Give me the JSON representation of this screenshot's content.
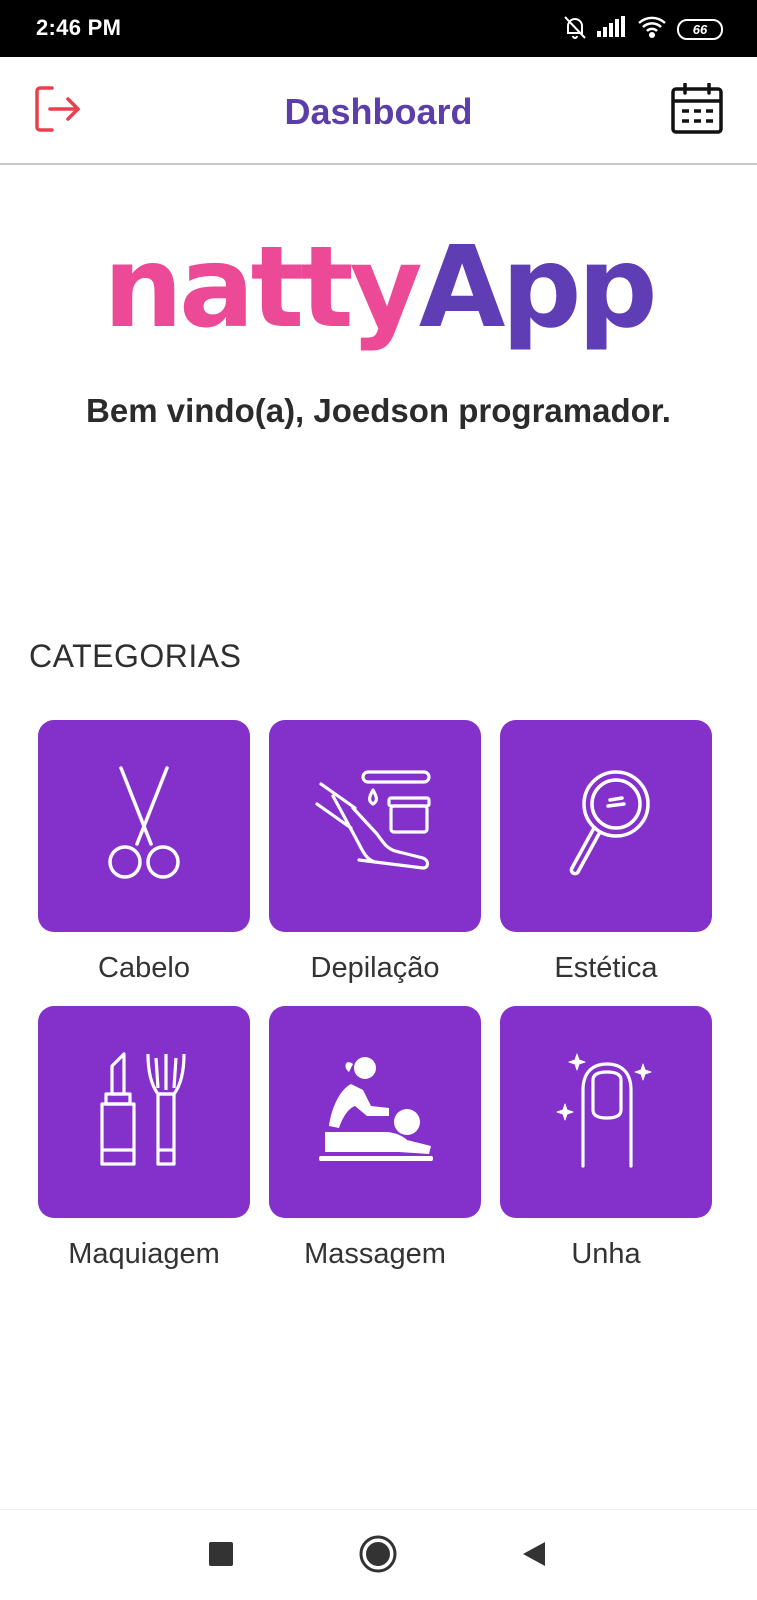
{
  "status_bar": {
    "time": "2:46 PM",
    "battery": "66",
    "icons": [
      "bell-off-icon",
      "signal-icon",
      "wifi-icon",
      "battery-icon"
    ]
  },
  "header": {
    "title": "Dashboard",
    "logout_icon": "logout-icon",
    "calendar_icon": "calendar-icon"
  },
  "logo": {
    "part1": "natty",
    "part2": "App",
    "color1": "#ec4a97",
    "color2": "#5e3db5"
  },
  "welcome": "Bem vindo(a), Joedson programador.",
  "categories": {
    "title": "CATEGORIAS",
    "tile_color": "#8431cb",
    "items": [
      {
        "label": "Cabelo",
        "icon": "scissors-icon"
      },
      {
        "label": "Depilação",
        "icon": "wax-leg-icon"
      },
      {
        "label": "Estética",
        "icon": "hand-mirror-icon"
      },
      {
        "label": "Maquiagem",
        "icon": "lipstick-brush-icon"
      },
      {
        "label": "Massagem",
        "icon": "massage-icon"
      },
      {
        "label": "Unha",
        "icon": "nail-icon"
      }
    ]
  },
  "navbar": {
    "buttons": [
      "recents-square-icon",
      "home-circle-icon",
      "back-triangle-icon"
    ]
  }
}
